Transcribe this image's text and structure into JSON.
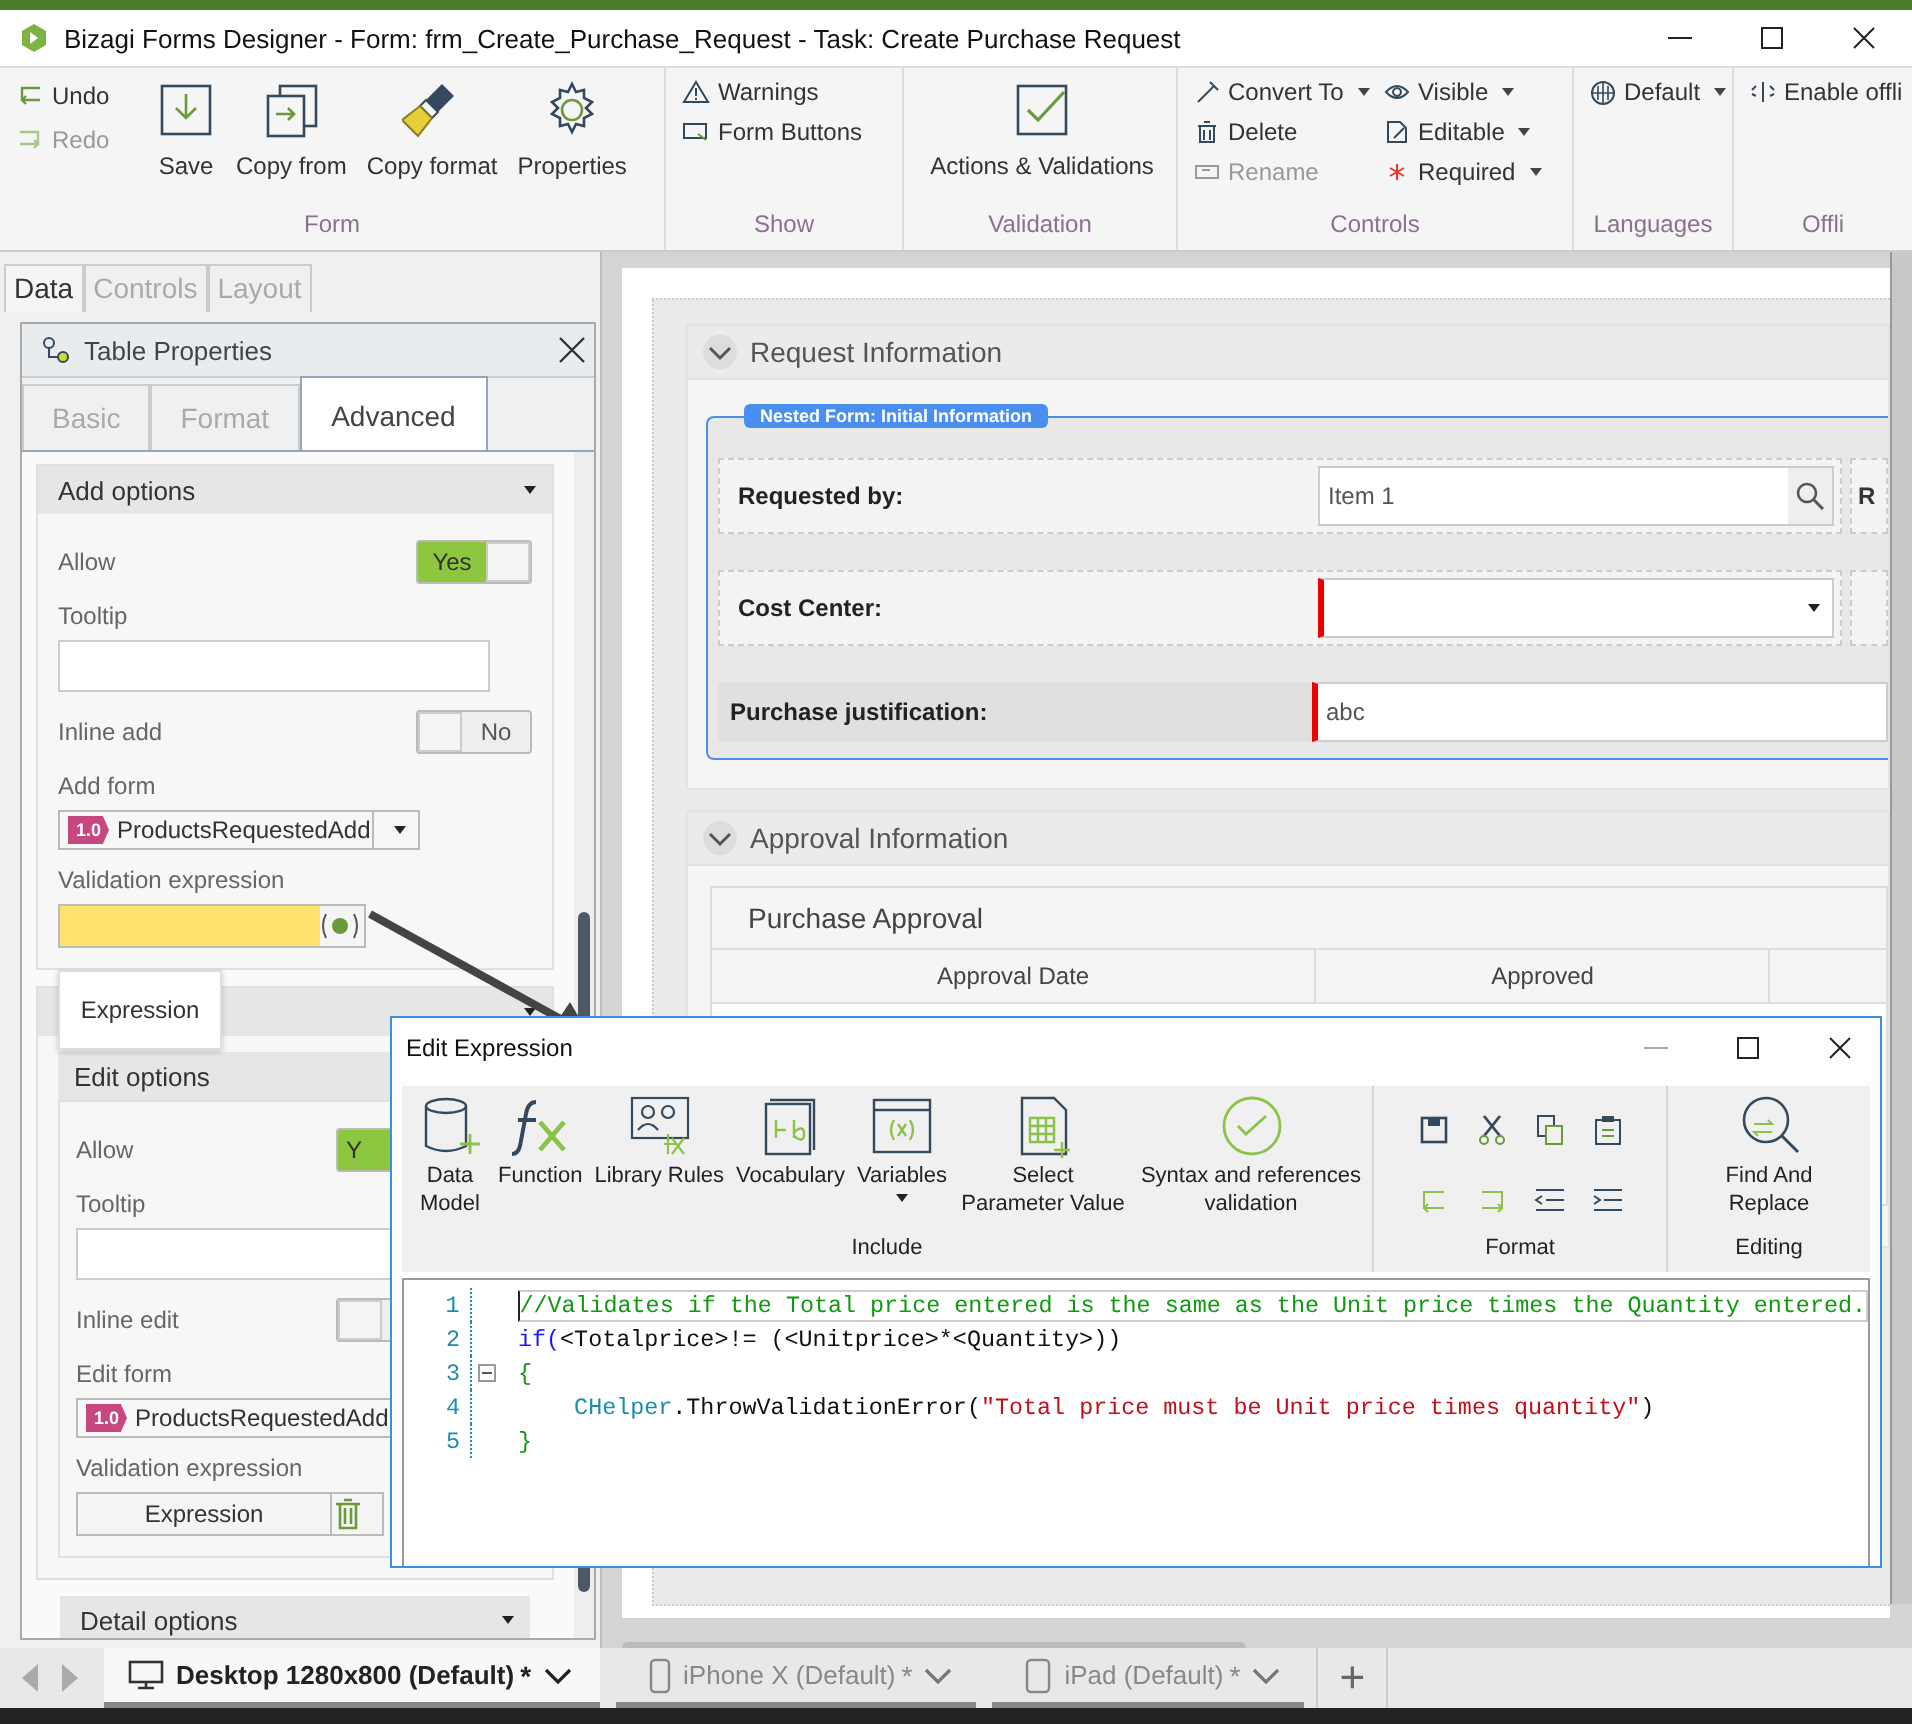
{
  "window": {
    "title": "Bizagi Forms Designer  - Form: frm_Create_Purchase_Request - Task:  Create Purchase Request"
  },
  "ribbon": {
    "form": {
      "label": "Form",
      "undo": {
        "label": "Undo",
        "disabled": false
      },
      "redo": {
        "label": "Redo",
        "disabled": true
      },
      "buttons": [
        "Save",
        "Copy from",
        "Copy format",
        "Properties"
      ]
    },
    "show": {
      "label": "Show",
      "items": [
        "Warnings",
        "Form Buttons"
      ]
    },
    "validation": {
      "label": "Validation",
      "button": "Actions & Validations"
    },
    "controls": {
      "label": "Controls",
      "items": [
        {
          "label": "Convert To",
          "dropdown": true,
          "disabled": false
        },
        {
          "label": "Delete",
          "dropdown": false,
          "disabled": false
        },
        {
          "label": "Rename",
          "dropdown": false,
          "disabled": true
        },
        {
          "label": "Visible",
          "dropdown": true,
          "disabled": false
        },
        {
          "label": "Editable",
          "dropdown": true,
          "disabled": false
        },
        {
          "label": "Required",
          "dropdown": true,
          "disabled": false
        }
      ]
    },
    "languages": {
      "label": "Languages",
      "value": "Default"
    },
    "offline": {
      "label": "Offli",
      "button": "Enable offli"
    }
  },
  "left_panel": {
    "tabs": [
      {
        "label": "Data",
        "selected": true
      },
      {
        "label": "Controls",
        "selected": false
      },
      {
        "label": "Layout",
        "selected": false
      }
    ],
    "properties": {
      "title": "Table Properties",
      "tabs": [
        {
          "label": "Basic",
          "selected": false
        },
        {
          "label": "Format",
          "selected": false
        },
        {
          "label": "Advanced",
          "selected": true
        }
      ],
      "add_options": {
        "header": "Add options",
        "allow": {
          "label": "Allow",
          "on": true,
          "text": "Yes"
        },
        "tooltip_label": "Tooltip",
        "inline": {
          "label": "Inline add",
          "on": false,
          "text": "No"
        },
        "form_label": "Add form",
        "form": {
          "version": "1.0",
          "value": "ProductsRequestedAdd"
        },
        "validation_label": "Validation expression"
      },
      "tooltip": "Expression",
      "edit_options": {
        "header": "Edit options",
        "allow": {
          "label": "Allow",
          "on": true,
          "text": "Y"
        },
        "tooltip_label": "Tooltip",
        "inline": {
          "label": "Inline edit",
          "on": false
        },
        "form_label": "Edit form",
        "form": {
          "version": "1.0",
          "value": "ProductsRequestedAdd"
        },
        "validation_label": "Validation expression",
        "expression_button": "Expression"
      },
      "detail_options": {
        "header": "Detail options"
      }
    }
  },
  "form": {
    "request": {
      "title": "Request Information",
      "expanded": true,
      "nested_badge": "Nested Form: Initial Information",
      "rows": [
        {
          "label": "Requested by:",
          "kind": "search",
          "value": "Item 1",
          "required": false,
          "column_2": "R"
        },
        {
          "label": "Cost Center:",
          "kind": "combo",
          "required": true
        },
        {
          "label": "Purchase justification:",
          "kind": "text",
          "value": "abc",
          "required": true
        }
      ]
    },
    "approval": {
      "title": "Approval Information",
      "expanded": true,
      "grid": {
        "title": "Purchase Approval",
        "columns": [
          "Approval Date",
          "Approved"
        ]
      }
    }
  },
  "dialog": {
    "title": "Edit Expression",
    "include": {
      "label": "Include",
      "items": [
        {
          "label": "Data Model",
          "dropdown": false
        },
        {
          "label": "Function",
          "dropdown": false
        },
        {
          "label": "Library Rules",
          "dropdown": false
        },
        {
          "label": "Vocabulary",
          "dropdown": false
        },
        {
          "label": "Variables",
          "dropdown": true
        },
        {
          "label": "Select Parameter Value",
          "dropdown": false
        },
        {
          "label": "Syntax and references validation",
          "dropdown": false
        }
      ]
    },
    "format": {
      "label": "Format"
    },
    "editing": {
      "label": "Editing",
      "button": "Find And Replace"
    },
    "code": [
      {
        "number": "1",
        "tokens": [
          {
            "text": "//Validates if the Total price entered is the same as the Unit price times the Quantity entered.",
            "kind": "comment"
          }
        ]
      },
      {
        "number": "2",
        "tokens": [
          {
            "text": "if(",
            "kind": "keyword"
          },
          {
            "text": "<Totalprice>!= (<Unitprice>*<Quantity>))",
            "kind": "plain"
          }
        ]
      },
      {
        "number": "3",
        "fold": true,
        "tokens": [
          {
            "text": "{",
            "kind": "comment"
          }
        ]
      },
      {
        "number": "4",
        "tokens": [
          {
            "text": "    CHelper",
            "kind": "class"
          },
          {
            "text": ".ThrowValidationError(",
            "kind": "plain"
          },
          {
            "text": "\"Total price must be Unit price times quantity\"",
            "kind": "string"
          },
          {
            "text": ")",
            "kind": "plain"
          }
        ]
      },
      {
        "number": "5",
        "tokens": [
          {
            "text": "}",
            "kind": "comment"
          }
        ]
      }
    ]
  },
  "device_tabs": {
    "tabs": [
      {
        "label": "Desktop 1280x800 (Default)",
        "mark": "*",
        "selected": true,
        "kind": "desktop"
      },
      {
        "label": "iPhone X (Default)",
        "mark": "*",
        "selected": false,
        "kind": "phone"
      },
      {
        "label": "iPad (Default)",
        "mark": "*",
        "selected": false,
        "kind": "tablet"
      }
    ],
    "add": "+"
  }
}
